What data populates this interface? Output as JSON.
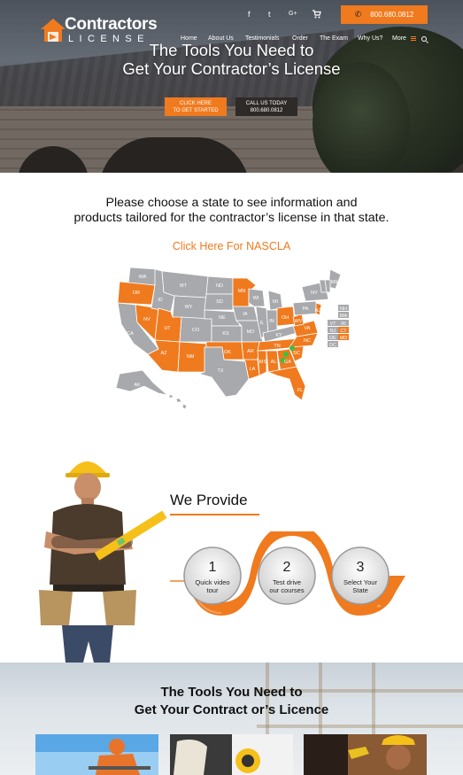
{
  "header": {
    "logo": {
      "word1": "Contractors",
      "word2": "LICENSE"
    },
    "social": {
      "facebook": "f",
      "twitter": "t",
      "google_plus": "G+"
    },
    "phone_button": {
      "label": "800.680.0812"
    },
    "nav": [
      {
        "label": "Home"
      },
      {
        "label": "About Us"
      },
      {
        "label": "Testimonials"
      },
      {
        "label": "Order"
      },
      {
        "label": "The Exam"
      },
      {
        "label": "Why Us?"
      },
      {
        "label": "More"
      }
    ]
  },
  "hero": {
    "title_line1": "The Tools You Need to",
    "title_line2": "Get Your Contractor’s License",
    "cta_primary": {
      "line1": "CLICK HERE",
      "line2": "TO GET STARTED"
    },
    "cta_call": {
      "line1": "CALL US TODAY",
      "line2": "800.680.0812"
    }
  },
  "states": {
    "intro_line1": "Please choose a state to see information and",
    "intro_line2": "products tailored for the contractor’s license in that state.",
    "nascla_link": "Click Here For NASCLA",
    "map_labels": [
      "WA",
      "OR",
      "ID",
      "MT",
      "ND",
      "MN",
      "WI",
      "MI",
      "NY",
      "VT",
      "NH",
      "ME",
      "MA",
      "RI",
      "CT",
      "NJ",
      "DE",
      "MD",
      "DC",
      "PA",
      "OH",
      "IN",
      "IL",
      "IA",
      "SD",
      "WY",
      "NE",
      "NV",
      "CA",
      "UT",
      "CO",
      "KS",
      "MO",
      "KY",
      "WV",
      "VA",
      "NC",
      "TN",
      "SC",
      "GA",
      "AL",
      "MS",
      "AR",
      "OK",
      "TX",
      "LA",
      "FL",
      "NM",
      "AZ",
      "AK",
      "HI"
    ],
    "colors": {
      "highlight": "#f07a1e",
      "default": "#a7a9ac",
      "marker": "#3fbf3f"
    }
  },
  "provide": {
    "title": "We Provide",
    "steps": [
      {
        "number": "1",
        "line1": "Quick video",
        "line2": "tour"
      },
      {
        "number": "2",
        "line1": "Test drive",
        "line2": "our courses"
      },
      {
        "number": "3",
        "line1": "Select Your",
        "line2": "State"
      }
    ]
  },
  "bottom": {
    "title_line1": "The Tools You Need to",
    "title_line2": "Get Your Contract or’s Licence"
  },
  "theme": {
    "accent": "#f07a1e",
    "dark": "#2e2a27"
  }
}
